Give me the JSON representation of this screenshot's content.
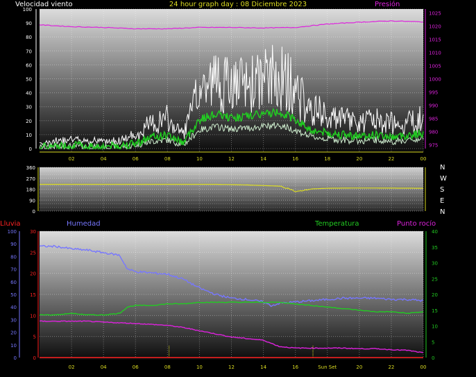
{
  "header": {
    "left_label": "Velocidad viento",
    "title": "24 hour graph day : 08 Diciembre 2023",
    "right_label": "Presión"
  },
  "wind_direction_labels": [
    "N",
    "W",
    "S",
    "E",
    "N"
  ],
  "bottom_labels": {
    "rain": "Lluvia",
    "humidity": "Humedad",
    "temperature": "Temperatura",
    "dewpoint": "Punto rocío",
    "sun_set": "Sun Set"
  },
  "colors": {
    "wind": "#ffffff",
    "wind_avg": "#22cc22",
    "gust": "#cfeecf",
    "pressure": "#dd22dd",
    "direction": "#dddd22",
    "humidity": "#7777ff",
    "temperature": "#22cc22",
    "dewpoint": "#dd22dd",
    "rain": "#ff2222",
    "axis_left": "#ffffff",
    "axis_yellow": "#dddd22"
  },
  "chart_data": [
    {
      "type": "line",
      "name_panel": "wind-pressure",
      "x_ticks": [
        "02",
        "04",
        "06",
        "08",
        "10",
        "12",
        "14",
        "16",
        "18",
        "20",
        "22",
        "00"
      ],
      "y_left_ticks": [
        "0",
        "10",
        "20",
        "30",
        "40",
        "50",
        "60",
        "70",
        "80",
        "90",
        "100"
      ],
      "ylim_left": [
        0,
        100
      ],
      "y_right_ticks": [
        "975",
        "980",
        "985",
        "990",
        "995",
        "1000",
        "1005",
        "1010",
        "1015",
        "1020",
        "1025"
      ],
      "ylim_right": [
        973.5,
        1026.5
      ],
      "series": [
        {
          "name": "Velocidad viento",
          "x": [
            0,
            1,
            2,
            3,
            4,
            5,
            6,
            7,
            8,
            9,
            10,
            11,
            12,
            13,
            14,
            15,
            16,
            17,
            18,
            19,
            20,
            21,
            22,
            23,
            24
          ],
          "values": [
            2,
            3,
            5,
            3,
            3,
            4,
            7,
            15,
            18,
            8,
            38,
            45,
            40,
            42,
            45,
            48,
            38,
            24,
            20,
            18,
            16,
            18,
            15,
            17,
            20
          ]
        },
        {
          "name": "Presión",
          "x": [
            0,
            2,
            4,
            6,
            8,
            10,
            12,
            14,
            16,
            18,
            20,
            22,
            24
          ],
          "values": [
            1020.5,
            1019.8,
            1019.5,
            1019.0,
            1019.0,
            1019.5,
            1019.5,
            1019.3,
            1019.5,
            1020.8,
            1021.5,
            1022.0,
            1021.6
          ]
        }
      ]
    },
    {
      "type": "line",
      "name_panel": "wind-direction",
      "x_ticks": [
        "02",
        "04",
        "06",
        "08",
        "10",
        "12",
        "14",
        "16",
        "18",
        "20",
        "22",
        "00"
      ],
      "y_ticks": [
        "0",
        "90",
        "180",
        "270",
        "360"
      ],
      "y_minor": [
        "30",
        "60",
        "120",
        "150",
        "210",
        "240",
        "300",
        "330"
      ],
      "ylim": [
        0,
        360
      ],
      "series": [
        {
          "name": "direction",
          "x": [
            0,
            6,
            10,
            11,
            12,
            13,
            14,
            15,
            15.6,
            16,
            16.3,
            17,
            18,
            20,
            24
          ],
          "values": [
            220,
            220,
            220,
            220,
            218,
            215,
            210,
            205,
            185,
            160,
            165,
            182,
            188,
            190,
            188
          ]
        }
      ]
    },
    {
      "type": "line",
      "name_panel": "temperature-humidity",
      "x_ticks": [
        "02",
        "04",
        "06",
        "08",
        "10",
        "12",
        "14",
        "16",
        "Sun Set",
        "20",
        "22",
        "00"
      ],
      "y_left_ticks": [
        "0",
        "10",
        "20",
        "30",
        "40",
        "50",
        "60",
        "70",
        "80",
        "90",
        "100"
      ],
      "y_rain_ticks": [
        "0",
        "5",
        "10",
        "15",
        "20",
        "25",
        "30"
      ],
      "y_right_ticks": [
        "0",
        "5",
        "10",
        "15",
        "20",
        "25",
        "30",
        "35",
        "40"
      ],
      "ylim_left": [
        0,
        100
      ],
      "ylim_right": [
        0,
        40
      ],
      "series": [
        {
          "name": "Humedad",
          "x": [
            0,
            1,
            2,
            3,
            4,
            5,
            5.5,
            6,
            7,
            8,
            9,
            10,
            11,
            12,
            13,
            14,
            14.5,
            15,
            16,
            17,
            18,
            19,
            20,
            21,
            22,
            23,
            24
          ],
          "values": [
            88,
            88,
            86,
            85,
            83,
            81,
            70,
            68,
            67,
            66,
            62,
            55,
            50,
            47,
            46,
            44,
            41,
            43,
            44,
            45,
            46,
            47,
            47,
            47,
            46,
            46,
            45
          ]
        },
        {
          "name": "Temperatura",
          "x": [
            0,
            1,
            2,
            3,
            4,
            5,
            5.5,
            6,
            7,
            8,
            9,
            10,
            11,
            12,
            13,
            14,
            15,
            16,
            17,
            18,
            19,
            20,
            21,
            22,
            23,
            24
          ],
          "values": [
            13.5,
            13.5,
            14,
            13.5,
            13.5,
            14,
            16,
            16.5,
            16.5,
            17,
            17,
            17.5,
            17.5,
            17.5,
            17.5,
            17.5,
            17.5,
            17,
            16.5,
            16,
            15.5,
            15,
            14.5,
            14.5,
            14,
            14.5
          ]
        },
        {
          "name": "Punto rocío",
          "x": [
            0,
            1,
            2,
            3,
            4,
            5,
            6,
            7,
            8,
            9,
            10,
            11,
            12,
            13,
            14,
            15,
            16,
            17,
            18,
            19,
            20,
            21,
            22,
            23,
            24
          ],
          "values": [
            11.5,
            11.5,
            11.5,
            11.5,
            11.2,
            11,
            10.8,
            10.5,
            10.2,
            9.5,
            8.5,
            7.5,
            6.5,
            6,
            5.5,
            3.5,
            3,
            3,
            3,
            3,
            2.8,
            2.8,
            2.5,
            2.3,
            1.5
          ]
        },
        {
          "name": "Lluvia",
          "x": [
            0,
            24
          ],
          "values": [
            0,
            0
          ]
        }
      ]
    }
  ]
}
